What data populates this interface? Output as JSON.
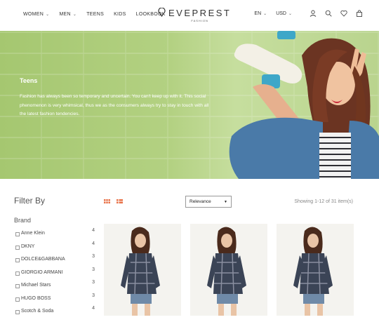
{
  "header": {
    "nav": [
      {
        "label": "WOMEN",
        "has_dropdown": true
      },
      {
        "label": "MEN",
        "has_dropdown": true
      },
      {
        "label": "TEENS",
        "has_dropdown": false
      },
      {
        "label": "KIDS",
        "has_dropdown": false
      },
      {
        "label": "LOOKBOOK",
        "has_dropdown": false
      }
    ],
    "logo_name": "EVEPREST",
    "logo_sub": "FASHION",
    "language": "EN",
    "currency": "USD",
    "icons": [
      "user-icon",
      "search-icon",
      "heart-icon",
      "bag-icon"
    ]
  },
  "hero": {
    "title": "Teens",
    "text": "Fashion has always been so temporary and uncertain. You can't keep up with it. This social phenomenon is very whimsical, thus we as the consumers always try to stay in touch with all the latest fashion tendencies."
  },
  "filter": {
    "title": "Filter By",
    "brand_title": "Brand",
    "brands": [
      {
        "label": "Anne Klein",
        "count": "4"
      },
      {
        "label": "DKNY",
        "count": "4"
      },
      {
        "label": "DOLCE&GABBANA",
        "count": "3"
      },
      {
        "label": "GIORGIO ARMANI",
        "count": "3"
      },
      {
        "label": "Michael Stars",
        "count": "3"
      },
      {
        "label": "HUGO BOSS",
        "count": "3"
      },
      {
        "label": "Scotch & Soda",
        "count": "4"
      }
    ]
  },
  "toolbar": {
    "sort_value": "Relevance",
    "showing": "Showing 1-12 of 31 item(s)"
  },
  "colors": {
    "accent": "#e8734a",
    "hero_green": "#b0cf7f"
  }
}
